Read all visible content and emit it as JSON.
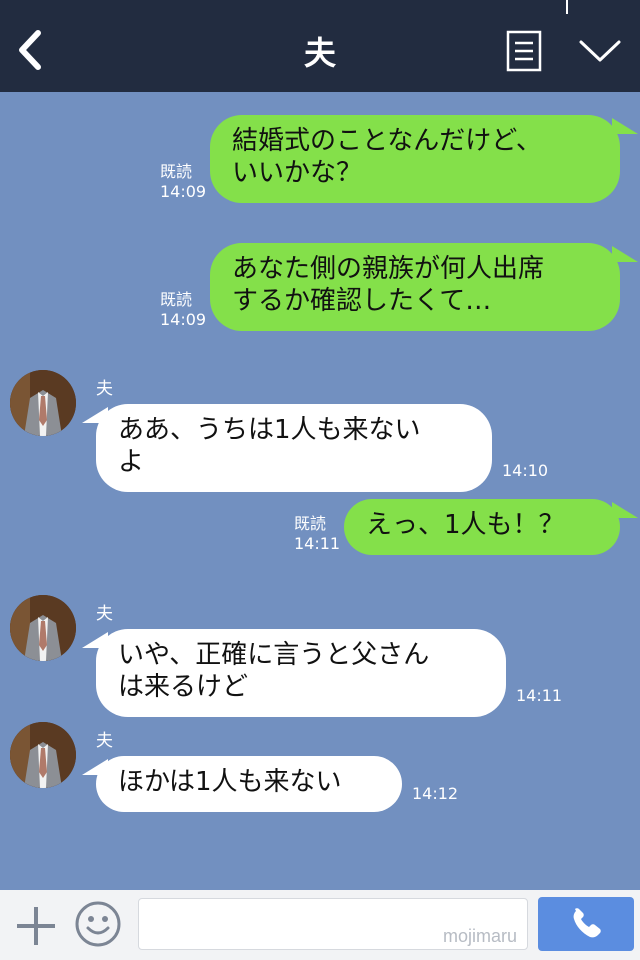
{
  "header": {
    "title": "夫"
  },
  "messages": [
    {
      "from": "me",
      "lines": [
        "結婚式のことなんだけど、",
        "いいかな？"
      ],
      "read": "既読",
      "time": "14:09"
    },
    {
      "from": "me",
      "lines": [
        "あなた側の親族が何人出席",
        "するか確認したくて…"
      ],
      "read": "既読",
      "time": "14:09"
    },
    {
      "from": "them",
      "sender": "夫",
      "lines": [
        "ああ、うちは1人も来ない",
        "よ"
      ],
      "time": "14:10"
    },
    {
      "from": "me",
      "lines": [
        "えっ、1人も！？"
      ],
      "read": "既読",
      "time": "14:11"
    },
    {
      "from": "them",
      "sender": "夫",
      "lines": [
        "いや、正確に言うと父さん",
        "は来るけど"
      ],
      "time": "14:11"
    },
    {
      "from": "them",
      "sender": "夫",
      "lines": [
        "ほかは1人も来ない"
      ],
      "time": "14:12"
    }
  ],
  "input": {
    "watermark": "mojimaru"
  },
  "colors": {
    "chat_bg": "#7290c0",
    "header_bg": "#222c40",
    "my_bubble": "#84e04a",
    "their_bubble": "#ffffff",
    "call_button": "#5b8de0"
  },
  "icons": [
    "back-chevron-icon",
    "menu-list-icon",
    "chevron-down-icon",
    "plus-icon",
    "emoji-icon",
    "phone-icon"
  ]
}
